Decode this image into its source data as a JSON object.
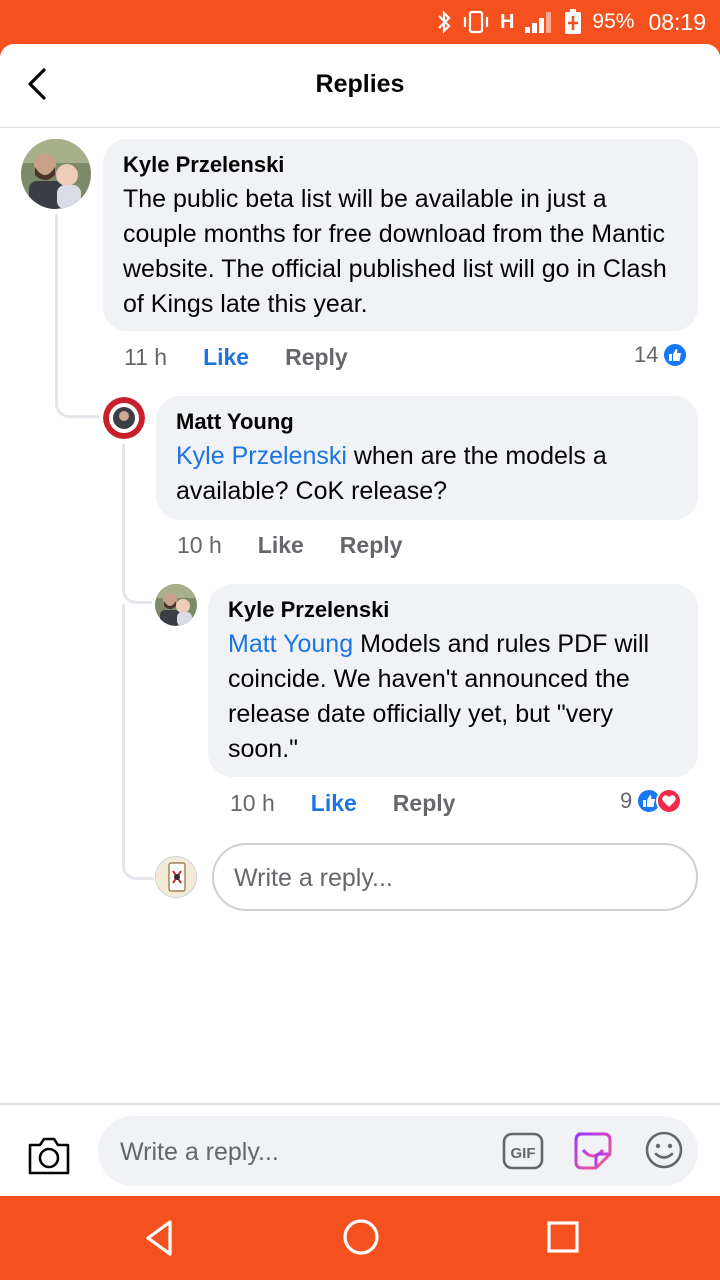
{
  "status_bar": {
    "network": "H",
    "battery": "95%",
    "time": "08:19"
  },
  "header": {
    "title": "Replies",
    "back_icon": "back-arrow-icon"
  },
  "comments": [
    {
      "author": "Kyle Przelenski",
      "mention": "",
      "text": "The public beta list will be available in just a couple months for free download from the Mantic website. The official published list will go in Clash of Kings late this year.",
      "time": "11 h",
      "like_label": "Like",
      "reply_label": "Reply",
      "reaction_count": "14",
      "reactions": [
        "like"
      ]
    },
    {
      "author": "Matt Young",
      "mention": "Kyle Przelenski",
      "text": " when are the models a available? CoK release?",
      "time": "10 h",
      "like_label": "Like",
      "reply_label": "Reply",
      "reaction_count": "",
      "reactions": []
    },
    {
      "author": "Kyle Przelenski",
      "mention": "Matt Young",
      "text": " Models and rules PDF will coincide. We haven't announced the release date officially yet, but \"very soon.\"",
      "time": "10 h",
      "like_label": "Like",
      "reply_label": "Reply",
      "reaction_count": "9",
      "reactions": [
        "like",
        "love"
      ]
    }
  ],
  "inline_reply": {
    "placeholder": "Write a reply..."
  },
  "composer": {
    "placeholder": "Write a reply...",
    "gif_label": "GIF"
  },
  "colors": {
    "brand": "#f4511e",
    "link": "#1b74e4",
    "bubble": "#f0f2f5",
    "like": "#1877f2",
    "love": "#f02849"
  }
}
